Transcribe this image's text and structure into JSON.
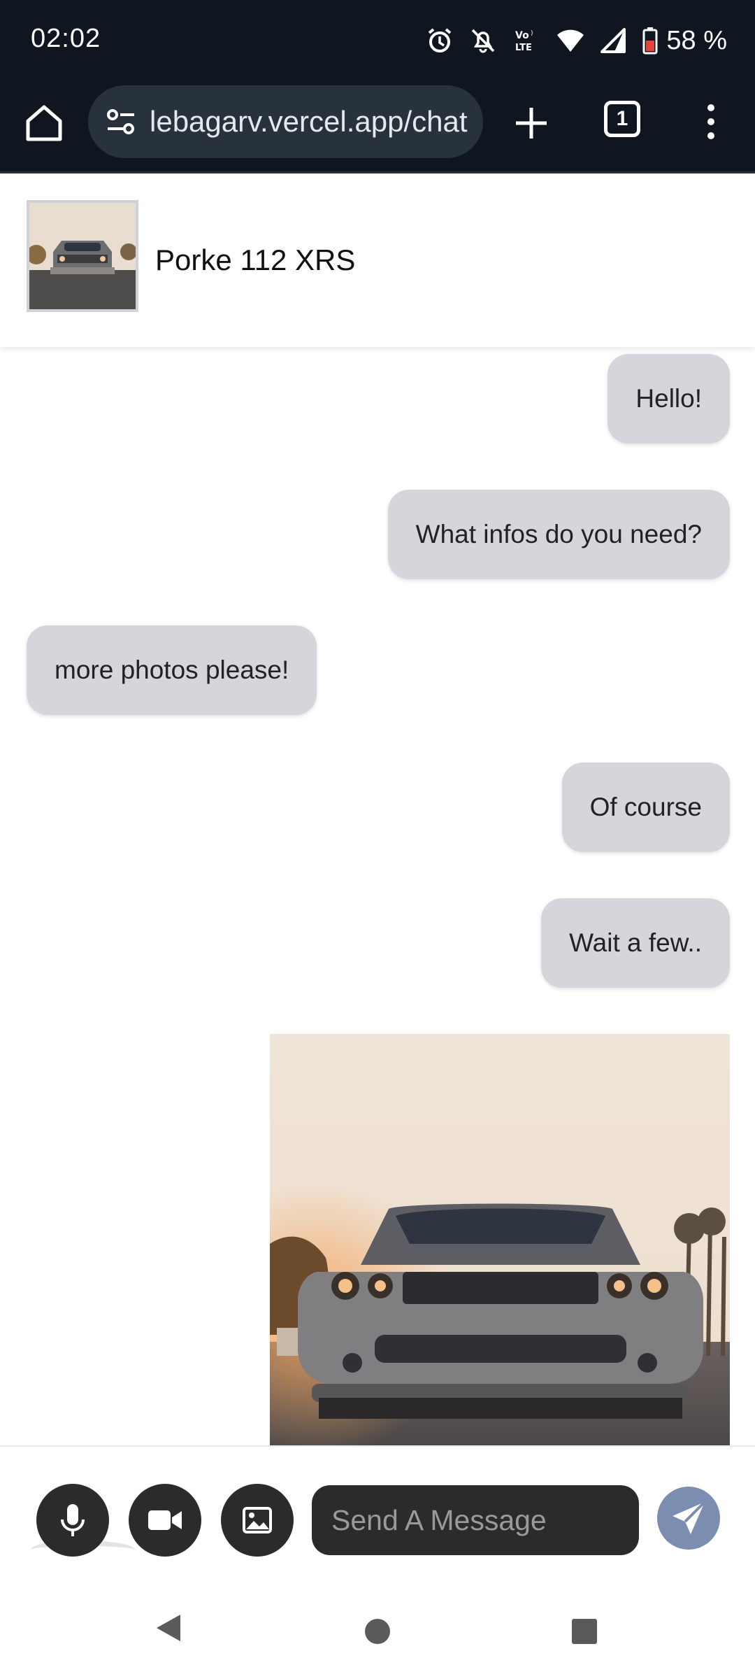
{
  "status_bar": {
    "time": "02:02",
    "battery": "58 %",
    "icons": [
      "alarm-icon",
      "bell-off-icon",
      "volte-icon",
      "wifi-icon",
      "signal-icon",
      "battery-icon"
    ]
  },
  "browser": {
    "url": "lebagarv.vercel.app/chat",
    "tab_count": "1"
  },
  "chat": {
    "contact_name": "Porke 112 XRS",
    "messages": [
      {
        "side": "right",
        "text": "Hello!"
      },
      {
        "side": "right",
        "text": "What infos do you need?"
      },
      {
        "side": "left",
        "text": "more photos please!"
      },
      {
        "side": "right",
        "text": "Of course"
      },
      {
        "side": "right",
        "text": "Wait a few.."
      }
    ]
  },
  "composer": {
    "placeholder": "Send A Message"
  },
  "colors": {
    "status_bg": "#0f1620",
    "bubble": "#d4d6dc",
    "send_button": "#7b8db0",
    "dark_button": "#2b2b2b"
  }
}
